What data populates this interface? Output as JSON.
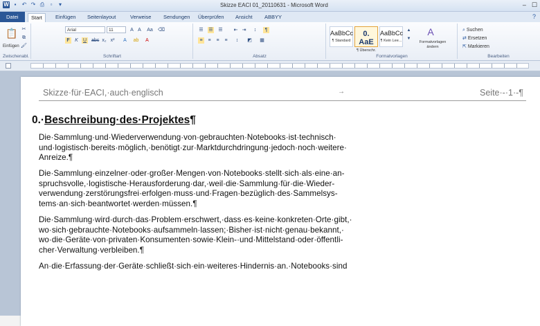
{
  "window": {
    "title": "Skizze EACI 01_20110631 - Microsoft Word"
  },
  "tabs": [
    {
      "label": "Datei"
    },
    {
      "label": "Start"
    },
    {
      "label": "Einfügen"
    },
    {
      "label": "Seitenlayout"
    },
    {
      "label": "Verweise"
    },
    {
      "label": "Sendungen"
    },
    {
      "label": "Überprüfen"
    },
    {
      "label": "Ansicht"
    },
    {
      "label": "ABBYY"
    }
  ],
  "ribbon": {
    "clipboard": {
      "paste_label": "Einfügen",
      "group_label": "Zwischenabl."
    },
    "font": {
      "font_name": "Arial",
      "font_size": "11",
      "group_label": "Schriftart"
    },
    "paragraph": {
      "group_label": "Absatz"
    },
    "styles": {
      "group_label": "Formatvorlagen",
      "change_styles_label": "Formatvorlagen ändern",
      "items": [
        {
          "sample": "AaBbCc",
          "name": "¶ Standard"
        },
        {
          "sample": "0. AaE",
          "name": "¶ Überschr."
        },
        {
          "sample": "AaBbCc",
          "name": "¶ Kein Lee..."
        }
      ]
    },
    "editing": {
      "group_label": "Bearbeiten",
      "find_label": "Suchen",
      "replace_label": "Ersetzen",
      "select_label": "Markieren"
    }
  },
  "document": {
    "header_left": "Skizze·für·EACI,·auch·englisch",
    "header_mid": "→",
    "header_right": "Seite·-·1·-¶",
    "heading_num": "0.·",
    "heading_text": "Beschreibung·des·Projektes",
    "heading_mark": "¶",
    "paragraphs": [
      {
        "lines": [
          "Die·Sammlung·und·Wiederverwendung·von·gebrauchten·Notebooks·ist·technisch·",
          "und·logistisch·bereits·möglich,·benötigt·zur·Marktdurchdringung·jedoch·noch·weitere·",
          "Anreize.¶"
        ]
      },
      {
        "lines": [
          "Die·Sammlung·einzelner·oder·großer·Mengen·von·Notebooks·stellt·sich·als·eine·an-",
          "spruchsvolle,·logistische·Herausforderung·dar,·weil·die·Sammlung·für·die·Wieder-",
          "verwendung·zerstörungsfrei·erfolgen·muss·und·Fragen·bezüglich·des·Sammelsys-",
          "tems·an·sich·beantwortet·werden·müssen.¶"
        ]
      },
      {
        "lines": [
          "Die·Sammlung·wird·durch·das·Problem·erschwert,·dass·es·keine·konkreten·Orte·gibt,·",
          "wo·sich·gebrauchte·Notebooks·aufsammeln·lassen;·Bisher·ist·nicht·genau·bekannt,·",
          "wo·die·Geräte·von·privaten·Konsumenten·sowie·Klein-·und·Mittelstand·oder·öffentli-",
          "cher·Verwaltung·verbleiben.¶"
        ]
      },
      {
        "lines": [
          "An·die·Erfassung·der·Geräte·schließt·sich·ein·weiteres·Hindernis·an.·Notebooks·sind"
        ]
      }
    ]
  }
}
